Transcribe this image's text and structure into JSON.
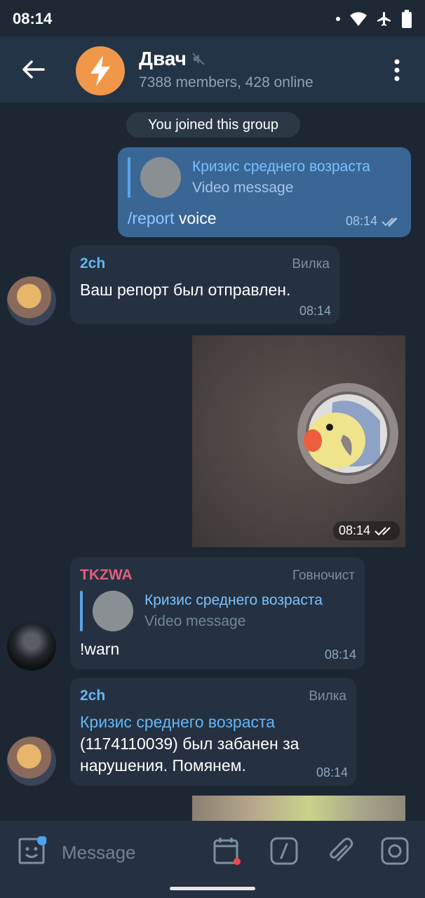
{
  "status_bar": {
    "time": "08:14"
  },
  "header": {
    "title": "Двач",
    "subtitle": "7388 members, 428 online",
    "muted": true
  },
  "service_message": "You joined this group",
  "messages": [
    {
      "type": "outgoing",
      "reply": {
        "name": "Кризис среднего возраста",
        "text": "Video message"
      },
      "command": "/report",
      "text": "voice",
      "time": "08:14"
    },
    {
      "type": "incoming",
      "sender": "2ch",
      "role": "Вилка",
      "text": "Ваш репорт был отправлен.",
      "time": "08:14"
    },
    {
      "type": "outgoing-media",
      "media": "cockatiel-in-tube-video",
      "time": "08:14"
    },
    {
      "type": "incoming",
      "sender": "TKZWA",
      "role": "Говночист",
      "reply": {
        "name": "Кризис среднего возраста",
        "text": "Video message"
      },
      "text": "!warn",
      "time": "08:14"
    },
    {
      "type": "incoming",
      "sender": "2ch",
      "role": "Вилка",
      "link": "Кризис среднего возраста",
      "line2": "(1174110039) был забанен за",
      "line3": "нарушения. Помянем.",
      "time": "08:14"
    }
  ],
  "input": {
    "placeholder": "Message"
  },
  "colors": {
    "accent": "#5ba4ea",
    "header_bg": "#243447",
    "chat_bg": "#1d2733",
    "outgoing": "#3a6696",
    "incoming": "#253140",
    "sender_red": "#e0607e"
  }
}
